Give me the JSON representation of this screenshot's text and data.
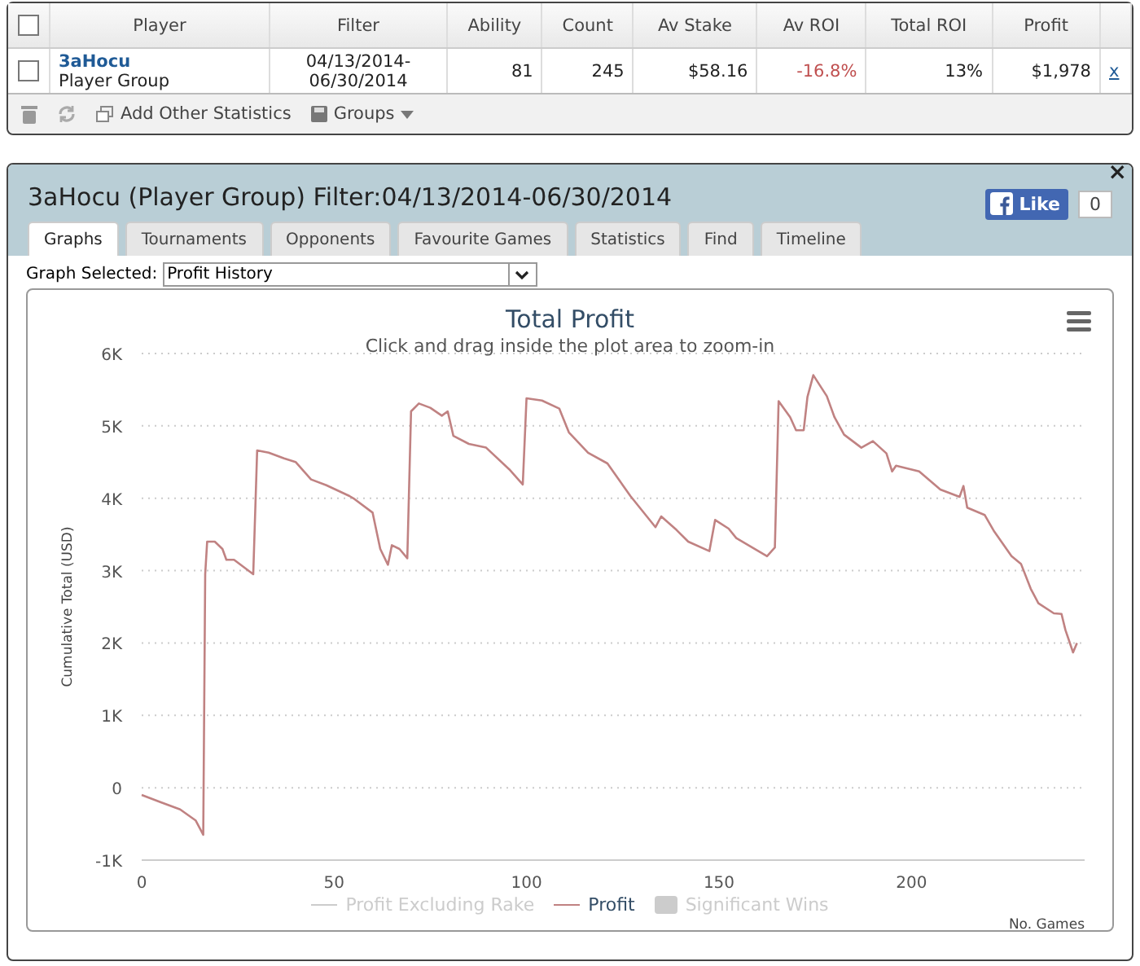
{
  "stats_table": {
    "columns": [
      "Player",
      "Filter",
      "Ability",
      "Count",
      "Av Stake",
      "Av ROI",
      "Total ROI",
      "Profit"
    ],
    "header_checked": false,
    "rows": [
      {
        "checked": false,
        "player_name": "3aHocu",
        "player_type": "Player Group",
        "filter": "04/13/2014-\n06/30/2014",
        "ability": "81",
        "count": "245",
        "av_stake": "$58.16",
        "av_roi": "-16.8%",
        "av_roi_negative": true,
        "total_roi": "13%",
        "profit": "$1,978",
        "remove": "x"
      }
    ],
    "toolbar": {
      "add_label": "Add Other Statistics",
      "groups_label": "Groups"
    }
  },
  "panel": {
    "title": "3aHocu (Player Group) Filter:04/13/2014-06/30/2014",
    "close": "×",
    "like": {
      "label": "Like",
      "count": "0"
    },
    "tabs": [
      {
        "label": "Graphs",
        "selected": true
      },
      {
        "label": "Tournaments",
        "selected": false
      },
      {
        "label": "Opponents",
        "selected": false
      },
      {
        "label": "Favourite Games",
        "selected": false
      },
      {
        "label": "Statistics",
        "selected": false
      },
      {
        "label": "Find",
        "selected": false
      },
      {
        "label": "Timeline",
        "selected": false
      }
    ],
    "graph_select": {
      "label": "Graph Selected:",
      "value": "Profit History"
    },
    "legend": [
      {
        "label": "Profit Excluding Rake",
        "kind": "line",
        "visible": false
      },
      {
        "kind": "series",
        "visible": true
      },
      {
        "label": "Significant Wins",
        "kind": "box",
        "visible": false
      }
    ],
    "chart_data": {
      "type": "line",
      "title": "Total Profit",
      "subtitle": "Click and drag inside the plot area to zoom-in",
      "xlabel": "No. Games",
      "ylabel": "Cumulative Total (USD)",
      "grid": true,
      "xlim": [
        0,
        245
      ],
      "ylim": [
        -1000,
        6000
      ],
      "xticks": [
        0,
        50,
        100,
        150,
        200
      ],
      "yticks": [
        {
          "value": -1000,
          "label": "-1K"
        },
        {
          "value": 0,
          "label": "0"
        },
        {
          "value": 1000,
          "label": "1K"
        },
        {
          "value": 2000,
          "label": "2K"
        },
        {
          "value": 3000,
          "label": "3K"
        },
        {
          "value": 4000,
          "label": "4K"
        },
        {
          "value": 5000,
          "label": "5K"
        },
        {
          "value": 6000,
          "label": "6K"
        }
      ],
      "x": [
        0,
        5,
        10,
        14,
        16,
        16.5,
        17,
        19,
        21,
        22,
        24,
        29,
        30,
        33,
        37,
        40,
        44,
        48,
        54,
        55,
        60,
        62,
        64,
        65,
        67,
        69,
        70,
        72,
        75,
        78,
        79.5,
        81,
        85,
        89.5,
        95.5,
        99,
        100,
        104,
        108.5,
        111,
        116,
        121,
        127,
        133.5,
        135,
        139,
        142,
        147.5,
        149,
        152.5,
        154.5,
        162.5,
        164.5,
        165.5,
        168.5,
        170,
        172,
        173,
        174.5,
        178,
        180,
        182.5,
        187,
        190,
        193.5,
        195,
        196,
        202,
        207.5,
        212.5,
        213.5,
        214.5,
        219,
        221.5,
        226,
        228.5,
        231,
        233,
        237,
        239,
        240,
        242,
        243
      ],
      "series": [
        {
          "name": "Profit",
          "color": "#c08282",
          "values": [
            -100,
            -200,
            -300,
            -450,
            -650,
            2950,
            3400,
            3400,
            3300,
            3150,
            3150,
            2950,
            4660,
            4630,
            4550,
            4500,
            4260,
            4180,
            4030,
            4000,
            3800,
            3300,
            3080,
            3350,
            3300,
            3170,
            5200,
            5310,
            5250,
            5140,
            5200,
            4860,
            4750,
            4700,
            4400,
            4190,
            5380,
            5350,
            5240,
            4910,
            4630,
            4480,
            4030,
            3600,
            3750,
            3560,
            3400,
            3270,
            3700,
            3580,
            3450,
            3200,
            3320,
            5340,
            5120,
            4940,
            4940,
            5400,
            5700,
            5410,
            5120,
            4880,
            4700,
            4790,
            4620,
            4370,
            4450,
            4370,
            4120,
            4020,
            4170,
            3870,
            3770,
            3540,
            3200,
            3090,
            2750,
            2550,
            2410,
            2400,
            2180,
            1870,
            2000
          ]
        }
      ]
    }
  }
}
